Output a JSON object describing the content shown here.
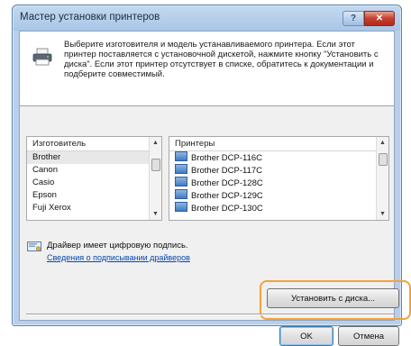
{
  "window": {
    "title": "Мастер установки принтеров",
    "help_label": "?",
    "close_label": "✕"
  },
  "header": {
    "icon": "printer-icon",
    "description": "Выберите изготовителя и модель устанавливаемого принтера. Если этот принтер поставляется с установочной дискетой, нажмите кнопку \"Установить с диска\". Если этот принтер отсутствует в списке, обратитесь к документации и подберите совместимый."
  },
  "manufacturers": {
    "header": "Изготовитель",
    "items": [
      "Brother",
      "Canon",
      "Casio",
      "Epson",
      "Fuji Xerox"
    ],
    "selected_index": 0
  },
  "printers": {
    "header": "Принтеры",
    "items": [
      "Brother DCP-116C",
      "Brother DCP-117C",
      "Brother DCP-128C",
      "Brother DCP-129C",
      "Brother DCP-130C"
    ]
  },
  "signature": {
    "icon": "signed-driver-icon",
    "text": "Драйвер имеет цифровую подпись.",
    "link": "Сведения о подписывании драйверов"
  },
  "buttons": {
    "have_disk": "Установить с диска...",
    "ok": "OK",
    "cancel": "Отмена"
  },
  "colors": {
    "highlight": "#f5a23a",
    "link": "#0645ad"
  }
}
